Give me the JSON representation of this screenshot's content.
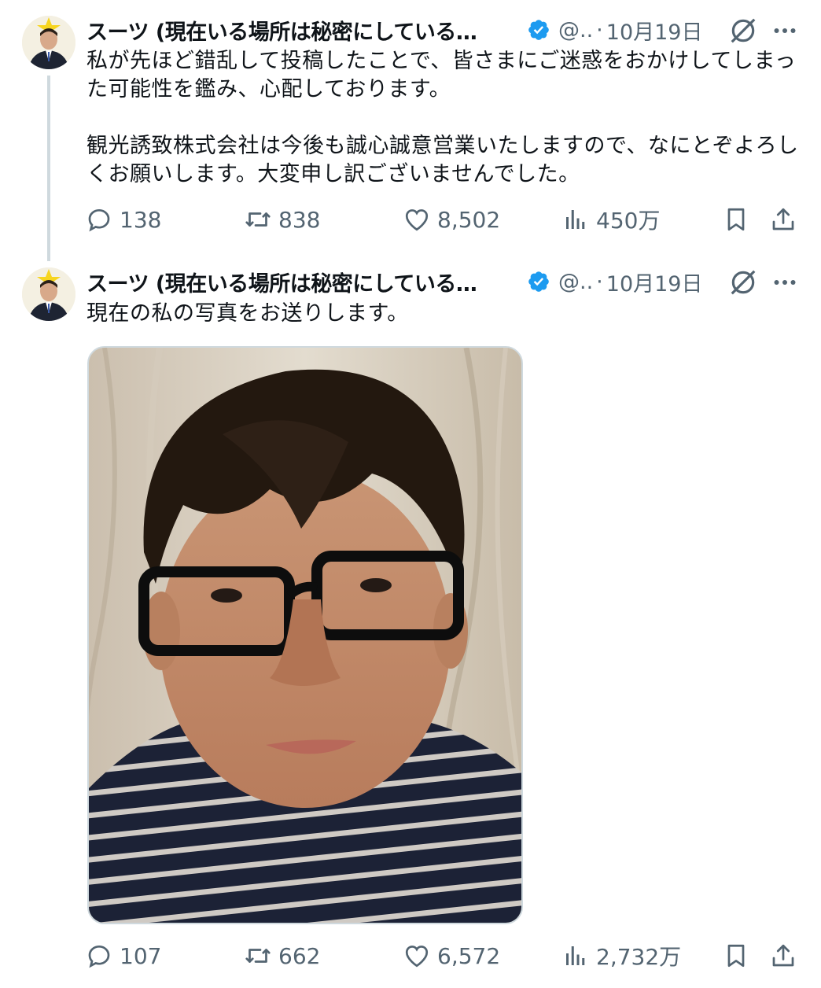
{
  "tweets": [
    {
      "author_name": "スーツ (現在いる場所は秘密にしている…",
      "handle": "@..",
      "separator": "·",
      "date": "10月19日",
      "text": "私が先ほど錯乱して投稿したことで、皆さまにご迷惑をおかけしてしまった可能性を鑑み、心配しております。\n\n観光誘致株式会社は今後も誠心誠意営業いたしますので、なにとぞよろしくお願いします。大変申し訳ございませんでした。",
      "replies": "138",
      "retweets": "838",
      "likes": "8,502",
      "views": "450万"
    },
    {
      "author_name": "スーツ (現在いる場所は秘密にしている…",
      "handle": "@..",
      "separator": "·",
      "date": "10月19日",
      "text": "現在の私の写真をお送りします。",
      "replies": "107",
      "retweets": "662",
      "likes": "6,572",
      "views": "2,732万"
    }
  ],
  "icons": {
    "verified": "verified-badge-icon",
    "grok": "grok-icon",
    "more": "more-icon",
    "reply": "reply-icon",
    "retweet": "retweet-icon",
    "like": "heart-icon",
    "views": "views-icon",
    "bookmark": "bookmark-icon",
    "share": "share-icon"
  },
  "colors": {
    "text": "#0f1419",
    "secondary": "#536471",
    "verified": "#1d9bf0",
    "thread_line": "#cfd9de"
  }
}
